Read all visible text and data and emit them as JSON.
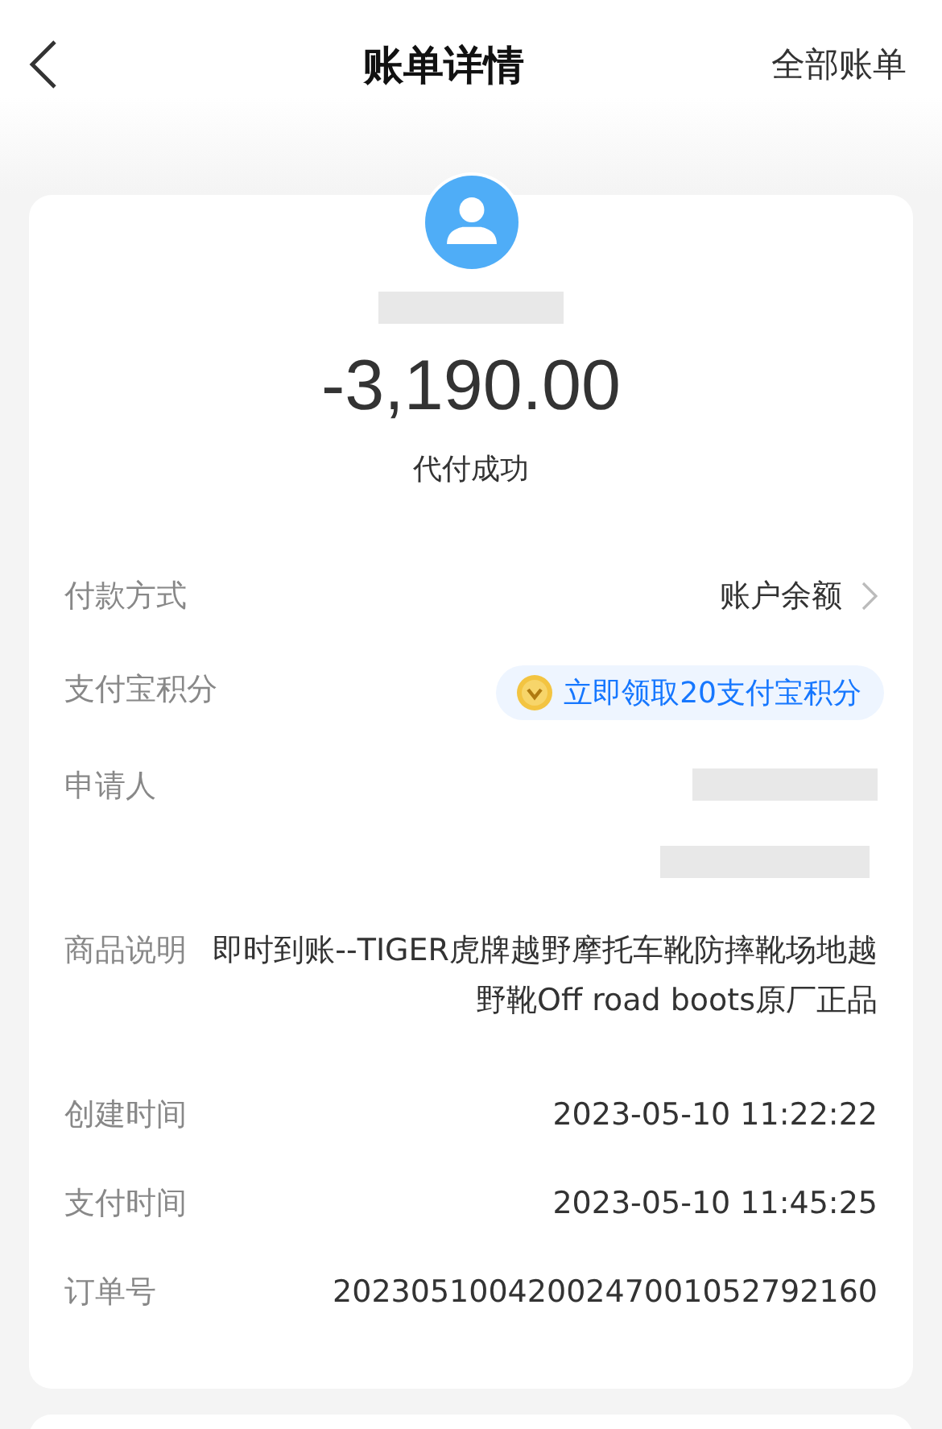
{
  "header": {
    "title": "账单详情",
    "action": "全部账单"
  },
  "summary": {
    "amount": "-3,190.00",
    "status": "代付成功"
  },
  "rows": [
    {
      "kind": "link",
      "label": "付款方式",
      "value": "账户余额"
    },
    {
      "kind": "badge",
      "label": "支付宝积分",
      "value": "立即领取20支付宝积分"
    },
    {
      "kind": "redacted",
      "label": "申请人"
    },
    {
      "kind": "text",
      "label": "商品说明",
      "value": "即时到账--TIGER虎牌越野摩托车靴防摔靴场地越野靴Off road boots原厂正品"
    },
    {
      "kind": "text",
      "label": "创建时间",
      "value": "2023-05-10 11:22:22"
    },
    {
      "kind": "text",
      "label": "支付时间",
      "value": "2023-05-10 11:45:25"
    },
    {
      "kind": "text",
      "label": "订单号",
      "value": "2023051004200247001052792160"
    }
  ]
}
